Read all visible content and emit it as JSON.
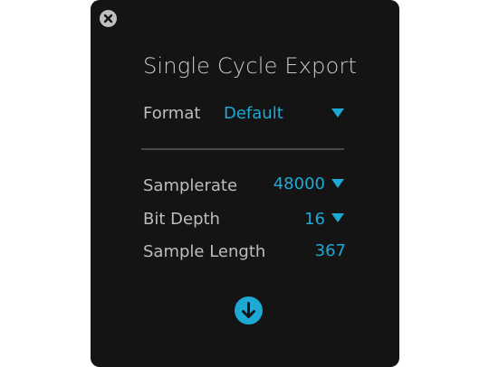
{
  "dialog": {
    "title": "Single Cycle Export",
    "format": {
      "label": "Format",
      "value": "Default"
    },
    "settings": [
      {
        "label": "Samplerate",
        "value": "48000",
        "dropdown": true
      },
      {
        "label": "Bit Depth",
        "value": "16",
        "dropdown": true
      },
      {
        "label": "Sample Length",
        "value": "367",
        "dropdown": false
      }
    ]
  },
  "icons": {
    "close": "close-icon",
    "dropdown": "triangle-down-icon",
    "download": "arrow-down-circle-icon"
  },
  "colors": {
    "panel_bg": "#141414",
    "accent": "#1ea9d4",
    "label_text": "#bdbdbd",
    "title_text": "#c9c9c9",
    "close_bg": "#bfbfbf"
  }
}
